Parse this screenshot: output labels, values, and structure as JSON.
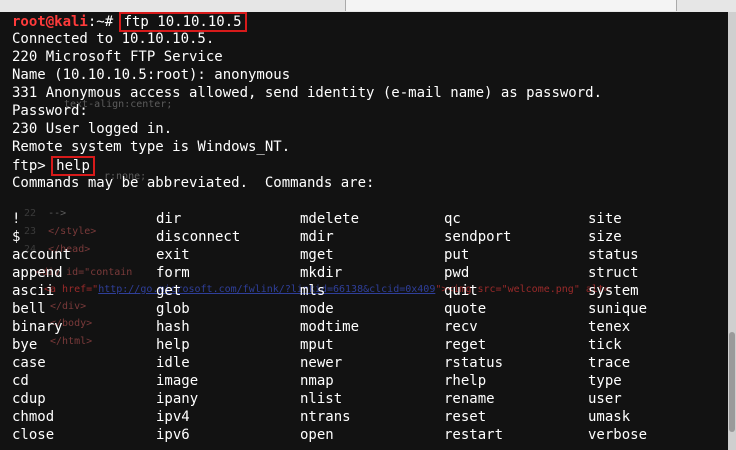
{
  "terminal": {
    "prompt_user": "root@kali",
    "prompt_path": ":~# ",
    "command1": "ftp 10.10.10.5",
    "output": [
      "Connected to 10.10.10.5.",
      "220 Microsoft FTP Service",
      "Name (10.10.10.5:root): anonymous",
      "331 Anonymous access allowed, send identity (e-mail name) as password.",
      "Password:",
      "230 User logged in.",
      "Remote system type is Windows_NT."
    ],
    "ftp_prompt": "ftp> ",
    "command2": "help",
    "help_header": "Commands may be abbreviated.  Commands are:"
  },
  "commands": [
    [
      "!",
      "dir",
      "mdelete",
      "qc",
      "site"
    ],
    [
      "$",
      "disconnect",
      "mdir",
      "sendport",
      "size"
    ],
    [
      "account",
      "exit",
      "mget",
      "put",
      "status"
    ],
    [
      "append",
      "form",
      "mkdir",
      "pwd",
      "struct"
    ],
    [
      "ascii",
      "get",
      "mls",
      "quit",
      "system"
    ],
    [
      "bell",
      "glob",
      "mode",
      "quote",
      "sunique"
    ],
    [
      "binary",
      "hash",
      "modtime",
      "recv",
      "tenex"
    ],
    [
      "bye",
      "help",
      "mput",
      "reget",
      "tick"
    ],
    [
      "case",
      "idle",
      "newer",
      "rstatus",
      "trace"
    ],
    [
      "cd",
      "image",
      "nmap",
      "rhelp",
      "type"
    ],
    [
      "cdup",
      "ipany",
      "nlist",
      "rename",
      "user"
    ],
    [
      "chmod",
      "ipv4",
      "ntrans",
      "reset",
      "umask"
    ],
    [
      "close",
      "ipv6",
      "open",
      "restart",
      "verbose"
    ]
  ],
  "background_code": {
    "l1": "text-align:center;",
    "l2": "r:none;",
    "l3_num": "22",
    "l3": "-->",
    "l4_num": "23",
    "l4": "</style>",
    "l5_num": "24",
    "l5": "</head>",
    "l6": "<div id=\"contain",
    "l7_pre": "<a href=\"",
    "l7_link": "http://go.microsoft.com/fwlink/?linkid=66138&clcid=0x409",
    "l7_post": "\"><img src=\"welcome.png\" alt=",
    "l8": "</div>",
    "l9": "</body>",
    "l10": "</html>"
  }
}
